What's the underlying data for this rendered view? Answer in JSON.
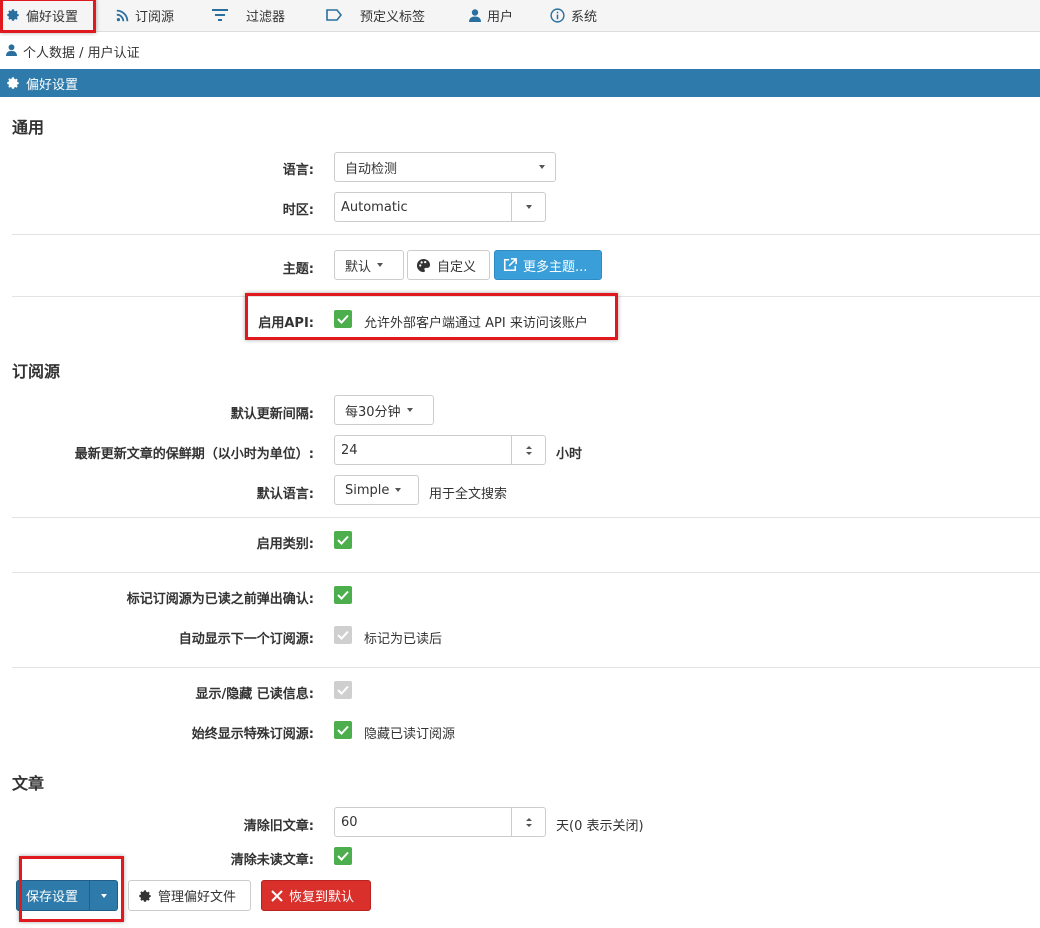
{
  "nav": {
    "tabs": [
      {
        "label": "偏好设置",
        "icon": "gear-icon"
      },
      {
        "label": "订阅源",
        "icon": "rss-icon"
      },
      {
        "label": "过滤器",
        "icon": "filter-icon"
      },
      {
        "label": "预定义标签",
        "icon": "label-icon"
      },
      {
        "label": "用户",
        "icon": "user-icon"
      },
      {
        "label": "系统",
        "icon": "info-icon"
      }
    ]
  },
  "breadcrumb": {
    "text": "个人数据 / 用户认证",
    "icon": "user-icon"
  },
  "panel": {
    "title": "偏好设置",
    "icon": "gear-icon",
    "color": "#2e7bab"
  },
  "general": {
    "heading": "通用",
    "language": {
      "label": "语言:",
      "value": "自动检测"
    },
    "timezone": {
      "label": "时区:",
      "value": "Automatic"
    },
    "theme": {
      "label": "主题:",
      "value": "默认",
      "customize": "自定义",
      "more": "更多主题..."
    },
    "api": {
      "label": "启用API:",
      "checked": true,
      "text": "允许外部客户端通过 API 来访问该账户"
    }
  },
  "feeds": {
    "heading": "订阅源",
    "update_interval": {
      "label": "默认更新间隔:",
      "value": "每30分钟"
    },
    "fresh_period": {
      "label": "最新更新文章的保鲜期（以小时为单位）:",
      "value": "24",
      "unit": "小时"
    },
    "default_lang": {
      "label": "默认语言:",
      "value": "Simple",
      "hint": "用于全文搜索"
    },
    "categories": {
      "label": "启用类别:",
      "checked": true
    },
    "confirm_read": {
      "label": "标记订阅源为已读之前弹出确认:",
      "checked": true
    },
    "show_next": {
      "label": "自动显示下一个订阅源:",
      "checked": true,
      "disabled": true,
      "text": "标记为已读后"
    },
    "toggle_read": {
      "label": "显示/隐藏 已读信息:",
      "checked": true,
      "disabled": true
    },
    "special": {
      "label": "始终显示特殊订阅源:",
      "checked": true,
      "text": "隐藏已读订阅源"
    }
  },
  "articles": {
    "heading": "文章",
    "purge_old": {
      "label": "清除旧文章:",
      "value": "60",
      "unit": "天(0 表示关闭)"
    },
    "purge_unread": {
      "label": "清除未读文章:",
      "checked": true
    }
  },
  "footer": {
    "save": "保存设置",
    "manage": "管理偏好文件",
    "reset": "恢复到默认"
  },
  "colors": {
    "accent": "#2e7bab",
    "checkbox": "#4cae4c",
    "danger": "#d9302c",
    "highlight": "#e0191e",
    "info_button": "#3a9fd9"
  }
}
